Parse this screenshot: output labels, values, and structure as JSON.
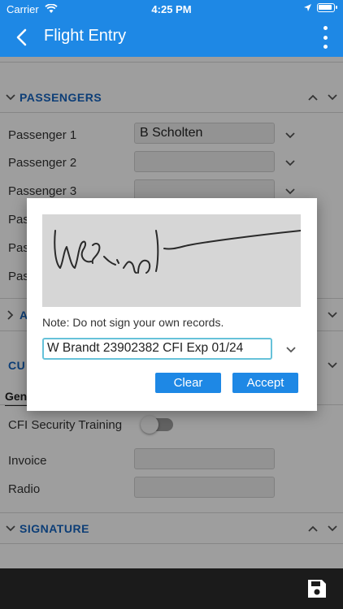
{
  "status_bar": {
    "carrier": "Carrier",
    "time": "4:25 PM"
  },
  "app_bar": {
    "title": "Flight Entry"
  },
  "sections": {
    "passengers": {
      "label": "PASSENGERS"
    },
    "second": {
      "label": "A"
    },
    "third": {
      "label": "CU"
    },
    "signature": {
      "label": "SIGNATURE"
    }
  },
  "passengers": {
    "rows": [
      {
        "label": "Passenger 1",
        "value": "B Scholten"
      },
      {
        "label": "Passenger 2",
        "value": ""
      },
      {
        "label": "Passenger 3",
        "value": ""
      },
      {
        "label": "Pas",
        "value": ""
      },
      {
        "label": "Pas",
        "value": ""
      },
      {
        "label": "Pas",
        "value": ""
      }
    ]
  },
  "custom": {
    "tab_label": "Gen",
    "toggle_label": "CFI Security Training",
    "toggle_on": false,
    "invoice_label": "Invoice",
    "invoice_value": "",
    "radio_label": "Radio",
    "radio_value": ""
  },
  "dialog": {
    "note": "Note: Do not sign your own records.",
    "signer": "W Brandt 23902382 CFI Exp 01/24",
    "clear_label": "Clear",
    "accept_label": "Accept"
  },
  "colors": {
    "accent": "#1e88e5",
    "section": "#1565c0",
    "bottom_bar": "#1b1b1b"
  }
}
